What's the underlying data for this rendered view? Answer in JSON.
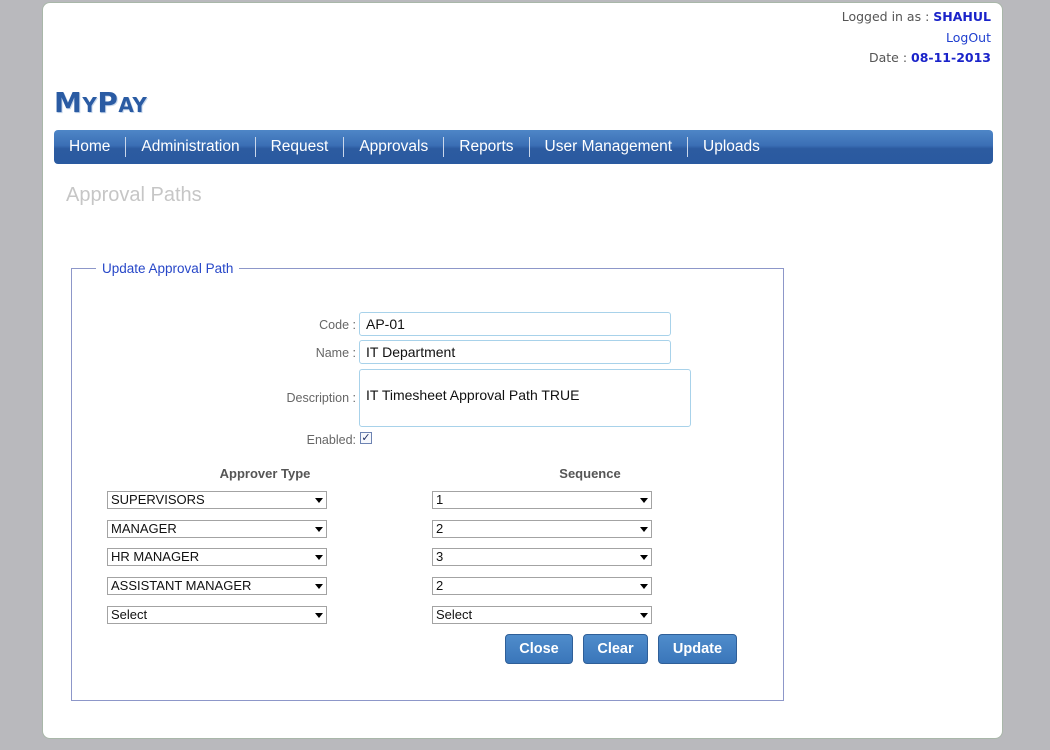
{
  "header": {
    "logged_in_label": "Logged in as :",
    "username": "SHAHUL",
    "logout_label": "LogOut",
    "date_label": "Date :",
    "date_value": "08-11-2013"
  },
  "logo": "MyPay",
  "nav": [
    "Home",
    "Administration",
    "Request",
    "Approvals",
    "Reports",
    "User Management",
    "Uploads"
  ],
  "page_title": "Approval Paths",
  "form": {
    "legend": "Update Approval Path",
    "code_label": "Code :",
    "code_value": "AP-01",
    "name_label": "Name :",
    "name_value": "IT Department",
    "description_label": "Description :",
    "description_value": "IT Timesheet Approval Path TRUE",
    "enabled_label": "Enabled:",
    "enabled_checked": true,
    "approver_type_header": "Approver Type",
    "sequence_header": "Sequence",
    "rows": [
      {
        "approver_type": "SUPERVISORS",
        "sequence": "1"
      },
      {
        "approver_type": "MANAGER",
        "sequence": "2"
      },
      {
        "approver_type": "HR MANAGER",
        "sequence": "3"
      },
      {
        "approver_type": "ASSISTANT MANAGER",
        "sequence": "2"
      },
      {
        "approver_type": "Select",
        "sequence": "Select"
      }
    ],
    "buttons": {
      "close": "Close",
      "clear": "Clear",
      "update": "Update"
    }
  }
}
